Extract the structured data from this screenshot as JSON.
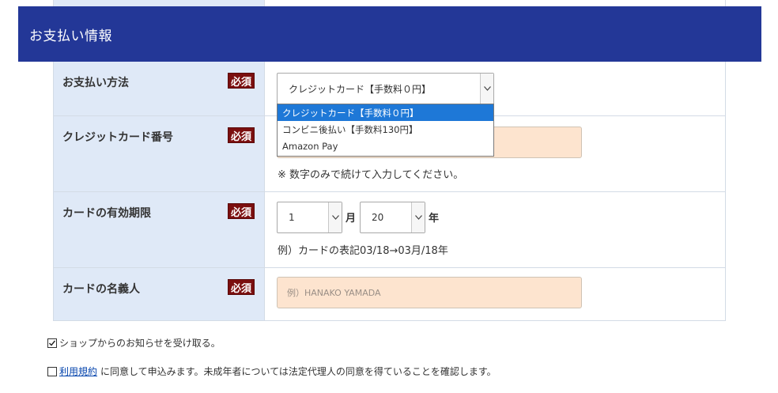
{
  "section_title": "お支払い情報",
  "required_label": "必須",
  "rows": {
    "payment_method": {
      "label": "お支払い方法",
      "selected": "クレジットカード【手数料０円】",
      "options": [
        "クレジットカード【手数料０円】",
        "コンビニ後払い【手数料130円】",
        "Amazon Pay"
      ]
    },
    "card_number": {
      "label": "クレジットカード番号",
      "value": "",
      "note": "※ 数字のみで続けて入力してください。"
    },
    "expiry": {
      "label": "カードの有効期限",
      "month": "1",
      "month_unit": "月",
      "year": "20",
      "year_unit": "年",
      "note": "例）カードの表記03/18→03月/18年"
    },
    "holder": {
      "label": "カードの名義人",
      "placeholder": "例）HANAKO YAMADA"
    }
  },
  "checkboxes": {
    "newsletter": {
      "checked": true,
      "label": "ショップからのお知らせを受け取る。"
    },
    "terms": {
      "checked": false,
      "link": "利用規約",
      "label": "に同意して申込みます。未成年者については法定代理人の同意を得ていることを確認します。"
    }
  },
  "colors": {
    "header_bg": "#233797",
    "label_bg": "#dfe9f7",
    "required_bg": "#7b0f0f",
    "input_bg": "#fde4cf",
    "option_highlight": "#1e78d7"
  }
}
